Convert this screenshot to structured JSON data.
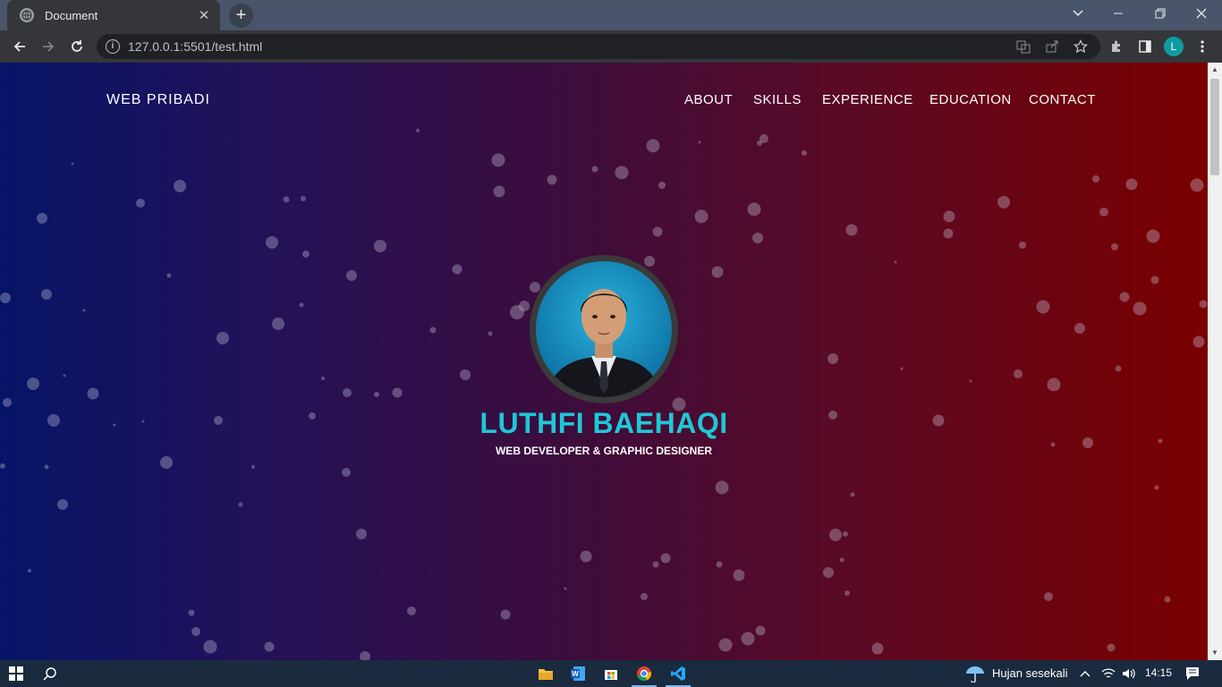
{
  "browser": {
    "tab_title": "Document",
    "tab_close": "✕",
    "new_tab": "+",
    "url": "127.0.0.1:5501/test.html",
    "profile_initial": "L"
  },
  "page": {
    "brand": "WEB PRIBADI",
    "nav": [
      "ABOUT",
      "SKILLS",
      "EXPERIENCE",
      "EDUCATION",
      "CONTACT"
    ],
    "name": "LUTHFI BAEHAQI",
    "subtitle": "WEB DEVELOPER & GRAPHIC DESIGNER",
    "gradient_colors": [
      "#061467",
      "#3a0d3e",
      "#7a0000"
    ],
    "accent_color": "#1ec8d6"
  },
  "taskbar": {
    "weather": "Hujan sesekali",
    "time": "14:15",
    "apps": [
      "file-explorer-icon",
      "word-icon",
      "store-icon",
      "chrome-icon",
      "vscode-icon"
    ]
  }
}
